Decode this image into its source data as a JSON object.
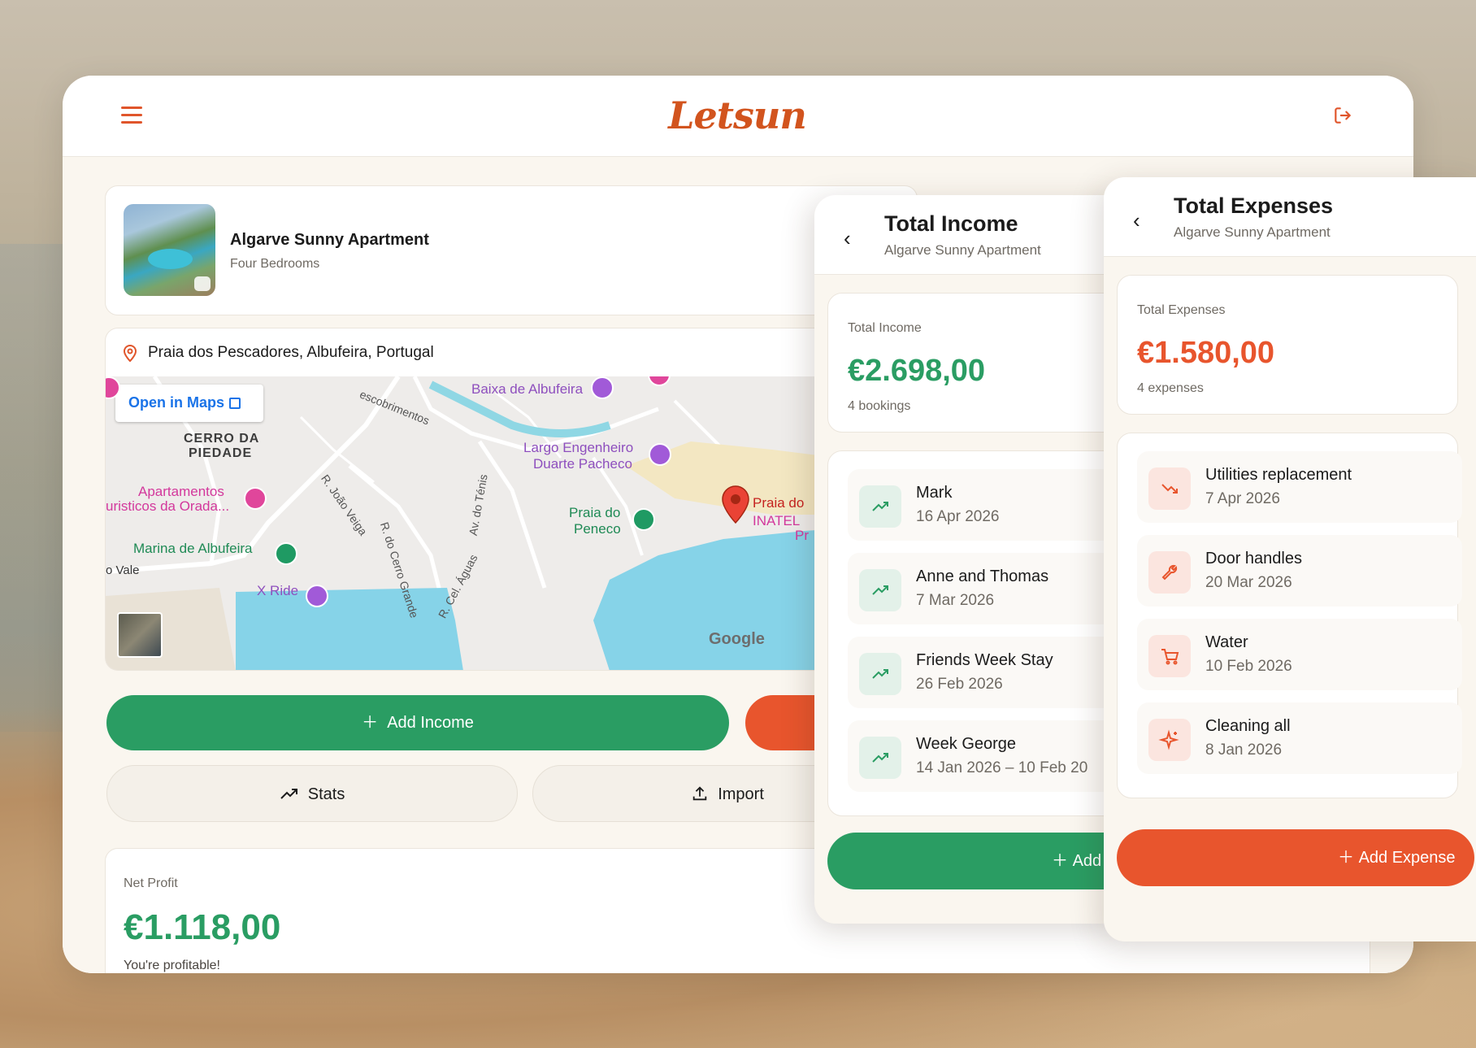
{
  "app": {
    "logo_text": "Letsun"
  },
  "property": {
    "name": "Algarve Sunny Apartment",
    "subtitle": "Four Bedrooms",
    "location": "Praia dos Pescadores, Albufeira, Portugal"
  },
  "map": {
    "open_link": "Open in Maps",
    "labels": {
      "cerro": "CERRO DA",
      "piedade": "PIEDADE",
      "baixa": "Baixa de Albufeira",
      "largo1": "Largo Engenheiro",
      "largo2": "Duarte Pacheco",
      "apart1": "Apartamentos",
      "apart2": "uristicos da Orada...",
      "praia_peneco1": "Praia do",
      "praia_peneco2": "Peneco",
      "praia_do": "Praia do",
      "inatel": "INATEL",
      "pr": "Pr",
      "marina": "Marina de Albufeira",
      "vale": "o Vale",
      "xride": "X Ride",
      "road_descobrimentos": "escobrimentos",
      "road_joao_veiga": "R. João Veiga",
      "road_cerro_grande": "R. do Cerro Grande",
      "road_tenis": "Av. do Ténis",
      "road_cel_aguas": "R. Cel. Águas",
      "google": "Google"
    }
  },
  "actions": {
    "add_income": "Add Income",
    "stats": "Stats",
    "import": "Import"
  },
  "net_profit": {
    "label": "Net Profit",
    "value": "€1.118,00",
    "note": "You're profitable!"
  },
  "income_panel": {
    "title": "Total Income",
    "subtitle": "Algarve Sunny Apartment",
    "summary_label": "Total Income",
    "summary_value": "€2.698,00",
    "summary_count": "4 bookings",
    "items": [
      {
        "title": "Mark",
        "date": "16 Apr 2026"
      },
      {
        "title": "Anne and Thomas",
        "date": "7 Mar 2026"
      },
      {
        "title": "Friends Week Stay",
        "date": "26 Feb 2026"
      },
      {
        "title": "Week George",
        "date": "14 Jan 2026 – 10 Feb 20"
      }
    ],
    "add_button": "Add"
  },
  "expense_panel": {
    "title": "Total Expenses",
    "subtitle": "Algarve Sunny Apartment",
    "summary_label": "Total Expenses",
    "summary_value": "€1.580,00",
    "summary_count": "4 expenses",
    "items": [
      {
        "title": "Utilities replacement",
        "date": "7 Apr 2026",
        "icon": "trending-down-icon"
      },
      {
        "title": "Door handles",
        "date": "20 Mar 2026",
        "icon": "wrench-icon"
      },
      {
        "title": "Water",
        "date": "10 Feb 2026",
        "icon": "cart-icon"
      },
      {
        "title": "Cleaning all",
        "date": "8 Jan 2026",
        "icon": "sparkle-icon"
      }
    ],
    "add_button": "Add Expense"
  },
  "colors": {
    "green": "#2a9d63",
    "orange": "#e8552d",
    "brand": "#d2541e"
  }
}
